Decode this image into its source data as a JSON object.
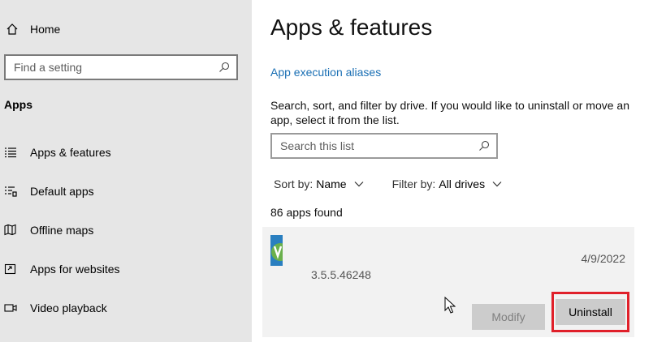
{
  "sidebar": {
    "home_label": "Home",
    "search_placeholder": "Find a setting",
    "section_title": "Apps",
    "items": [
      {
        "label": "Apps & features",
        "icon": "apps-features-icon"
      },
      {
        "label": "Default apps",
        "icon": "default-apps-icon"
      },
      {
        "label": "Offline maps",
        "icon": "offline-maps-icon"
      },
      {
        "label": "Apps for websites",
        "icon": "apps-for-websites-icon"
      },
      {
        "label": "Video playback",
        "icon": "video-playback-icon"
      }
    ]
  },
  "main": {
    "title": "Apps & features",
    "link": "App execution aliases",
    "description": "Search, sort, and filter by drive. If you would like to uninstall or move an app, select it from the list.",
    "list_search_placeholder": "Search this list",
    "sort_label": "Sort by:",
    "sort_value": "Name",
    "filter_label": "Filter by:",
    "filter_value": "All drives",
    "count": "86 apps found",
    "app": {
      "version": "3.5.5.46248",
      "date": "4/9/2022",
      "modify_label": "Modify",
      "uninstall_label": "Uninstall"
    }
  },
  "colors": {
    "sidebar_bg": "#e6e6e6",
    "link": "#1a6fb4",
    "highlight": "#e0202a",
    "button_bg": "#cccccc"
  }
}
